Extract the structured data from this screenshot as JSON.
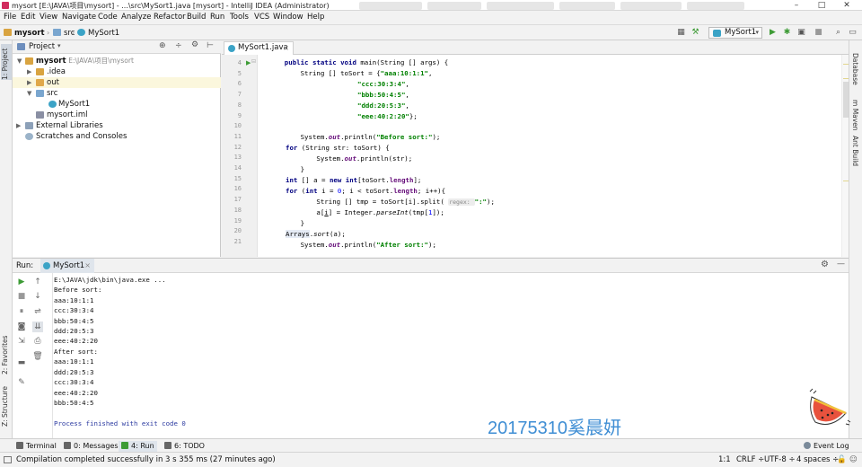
{
  "window": {
    "title": "mysort [E:\\JAVA\\项目\\mysort] - ...\\src\\MySort1.java [mysort] - IntelliJ IDEA (Administrator)"
  },
  "menu": [
    "File",
    "Edit",
    "View",
    "Navigate",
    "Code",
    "Analyze",
    "Refactor",
    "Build",
    "Run",
    "Tools",
    "VCS",
    "Window",
    "Help"
  ],
  "breadcrumbs": [
    "mysort",
    "src",
    "MySort1"
  ],
  "toolbar": {
    "run_config": "MySort1"
  },
  "left_tabs": {
    "project": "1: Project",
    "favorites": "2: Favorites",
    "structure": "Z: Structure"
  },
  "right_tabs": {
    "database": "Database",
    "maven": "m Maven",
    "ant": "Ant Build"
  },
  "project": {
    "header": "Project",
    "tree": [
      {
        "label": "mysort",
        "hint": "E:\\JAVA\\项目\\mysort"
      },
      {
        "label": ".idea"
      },
      {
        "label": "out"
      },
      {
        "label": "src"
      },
      {
        "label": "MySort1"
      },
      {
        "label": "mysort.iml"
      },
      {
        "label": "External Libraries"
      },
      {
        "label": "Scratches and Consoles"
      }
    ]
  },
  "editor": {
    "tab": "MySort1.java",
    "line_numbers": [
      "4",
      "5",
      "6",
      "7",
      "8",
      "9",
      "10",
      "11",
      "12",
      "13",
      "14",
      "15",
      "16",
      "17",
      "18",
      "19",
      "20",
      "21"
    ],
    "code": {
      "l4_a": "    public static void ",
      "l4_b": "main(String [] args) {",
      "l5_a": "        String [] toSort = {",
      "l5_b": "\"aaa:10:1:1\"",
      "l5_c": ",",
      "l6_b": "\"ccc:30:3:4\"",
      "l6_c": ",",
      "l7_b": "\"bbb:50:4:5\"",
      "l7_c": ",",
      "l8_b": "\"ddd:20:5:3\"",
      "l8_c": ",",
      "l9_b": "\"eee:40:2:20\"",
      "l9_c": "};",
      "l11_a": "        System.",
      "l11_b": "out",
      "l11_c": ".println(",
      "l11_d": "\"Before sort:\"",
      "l11_e": ");",
      "l12_a": "for",
      "l12_b": " (String str: toSort) {",
      "l13_a": "            System.",
      "l13_b": "out",
      "l13_c": ".println(str);",
      "l14_a": "        }",
      "l15_a": "int",
      "l15_b": " [] a = ",
      "l15_c": "new int",
      "l15_d": "[toSort.",
      "l15_e": "length",
      "l15_f": "];",
      "l16_a": "for",
      "l16_b": " (",
      "l16_c": "int",
      "l16_d": " i = ",
      "l16_e": "0",
      "l16_f": "; i < toSort.",
      "l16_g": "length",
      "l16_h": "; i++){",
      "l17_a": "            String [] tmp = toSort[i].split( ",
      "l17_b": "regex: ",
      "l17_c": "\":\"",
      "l17_d": ");",
      "l18_a": "            a[",
      "l18_b": "i",
      "l18_c": "] = Integer.",
      "l18_d": "parseInt",
      "l18_e": "(tmp[",
      "l18_f": "1",
      "l18_g": "]);",
      "l19_a": "        }",
      "l20_a": "Arrays",
      "l20_b": ".",
      "l20_c": "sort",
      "l20_d": "(a);",
      "l21_a": "        System.",
      "l21_b": "out",
      "l21_c": ".println(",
      "l21_d": "\"After sort:\"",
      "l21_e": ");"
    }
  },
  "run": {
    "label": "Run:",
    "tab": "MySort1",
    "console": [
      "E:\\JAVA\\jdk\\bin\\java.exe ...",
      "Before sort:",
      "aaa:10:1:1",
      "ccc:30:3:4",
      "bbb:50:4:5",
      "ddd:20:5:3",
      "eee:40:2:20",
      "After sort:",
      "aaa:10:1:1",
      "ddd:20:5:3",
      "ccc:30:3:4",
      "eee:40:2:20",
      "bbb:50:4:5",
      "",
      "Process finished with exit code 0"
    ],
    "watermark": "20175310奚晨妍"
  },
  "bottom_tabs": {
    "terminal": "Terminal",
    "messages": "0: Messages",
    "run": "4: Run",
    "todo": "6: TODO",
    "event_log": "Event Log"
  },
  "status": {
    "message": "Compilation completed successfully in 3 s 355 ms (27 minutes ago)",
    "position": "1:1",
    "line_sep": "CRLF ÷",
    "encoding": "UTF-8 ÷",
    "indent": "4 spaces ÷"
  },
  "colors": {
    "keyword": "#000080",
    "string": "#008000",
    "field": "#660e7a",
    "watermark": "#3f8ed4",
    "run_green": "#3d9b35"
  }
}
